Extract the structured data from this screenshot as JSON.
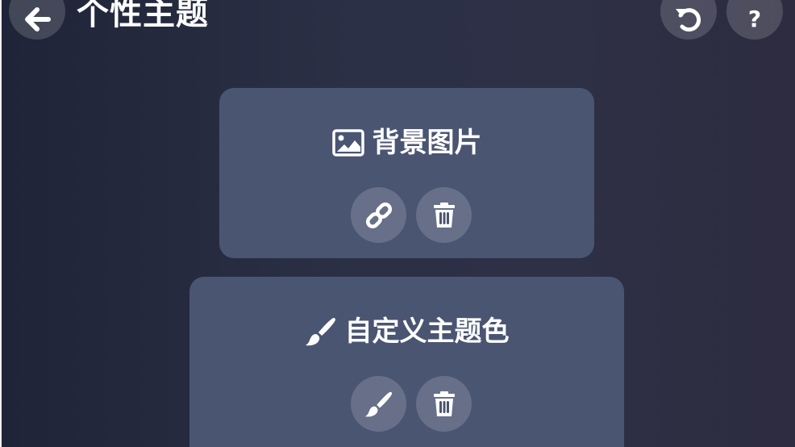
{
  "header": {
    "title": "个性主题",
    "back_icon": "arrow-left-icon",
    "reset_icon": "undo-icon",
    "help_icon": "question-icon",
    "help_glyph": "?"
  },
  "cards": {
    "background_image": {
      "title": "背景图片",
      "title_icon": "image-icon",
      "actions": [
        {
          "icon": "link-icon"
        },
        {
          "icon": "trash-icon"
        }
      ]
    },
    "custom_color": {
      "title": "自定义主题色",
      "title_icon": "paintbrush-icon",
      "actions": [
        {
          "icon": "paintbrush-icon"
        },
        {
          "icon": "trash-icon"
        }
      ]
    }
  },
  "colors": {
    "card": "#4a5572",
    "background_dark": "#1f2438",
    "text": "#ffffff"
  }
}
